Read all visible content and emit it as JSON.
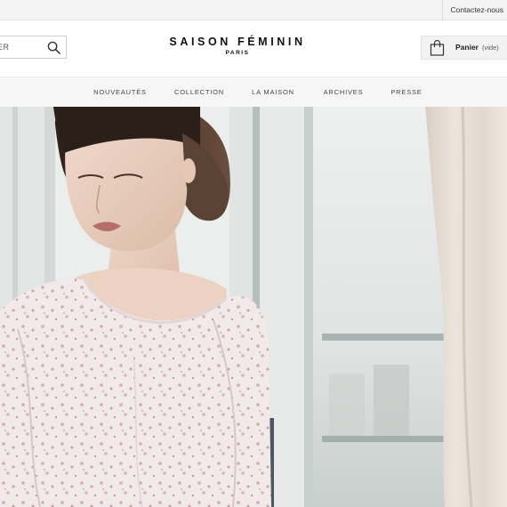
{
  "topbar": {
    "contact_label": "Contactez-nous"
  },
  "header": {
    "search": {
      "text": "ER"
    },
    "logo": {
      "brand": "SAISON FÉMININ",
      "city": "PARIS"
    },
    "cart": {
      "label": "Panier",
      "status": "(vide)"
    }
  },
  "nav": {
    "items": [
      {
        "label": "NOUVEAUTÉS"
      },
      {
        "label": "COLLECTION"
      },
      {
        "label": "LA MAISON"
      },
      {
        "label": "ARCHIVES"
      },
      {
        "label": "PRESSE"
      }
    ]
  },
  "colors": {
    "topbar_bg": "#f4f4f4",
    "nav_bg": "#f6f6f6",
    "cart_bg": "#f2f2f2",
    "text_dark": "#111111"
  },
  "icons": [
    "search-icon",
    "shopping-bag-icon"
  ]
}
